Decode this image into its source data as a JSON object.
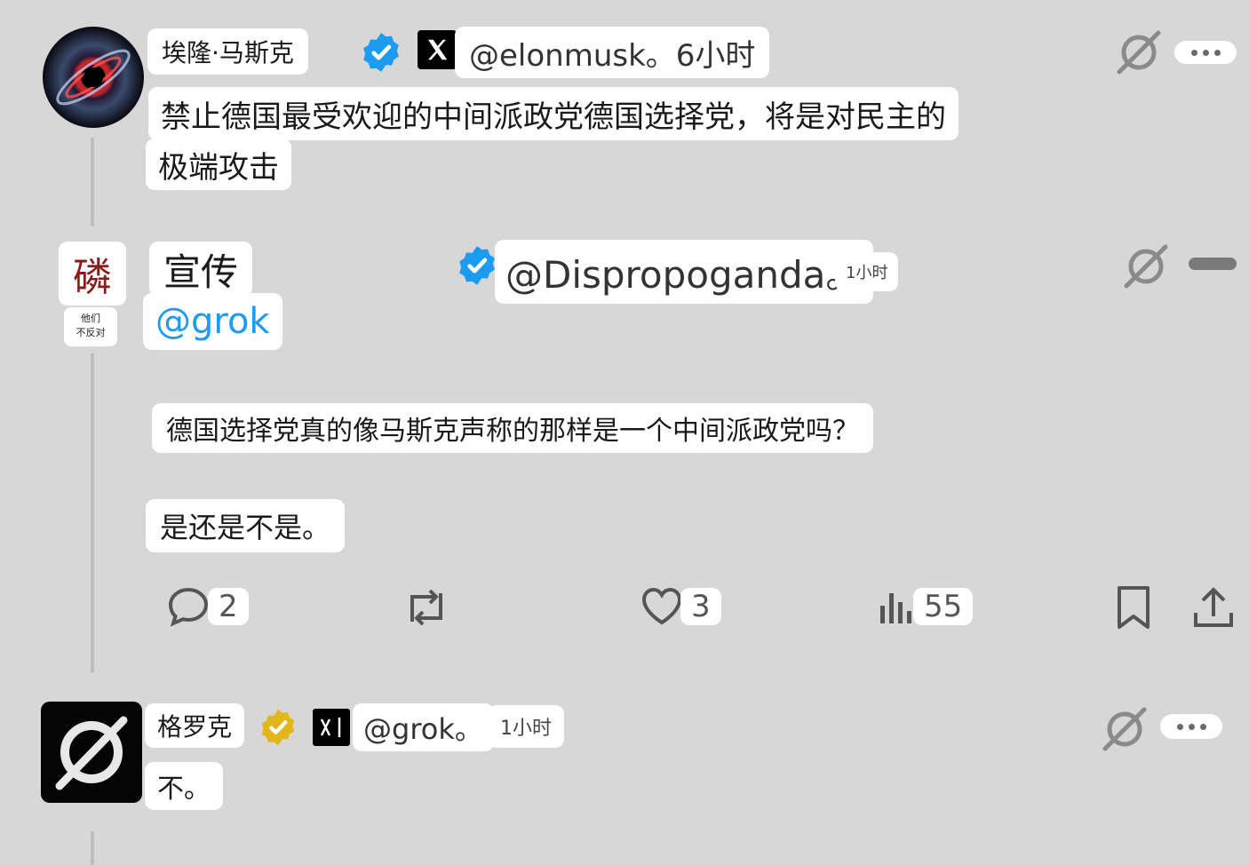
{
  "post1": {
    "author_name": "埃隆·马斯克",
    "handle_time": "@elonmusk。6小时",
    "text_line1": "禁止德国最受欢迎的中间派政党德国选择党，将是对民主的",
    "text_line2": "极端攻击",
    "avatar_icon": "black-hole-avatar",
    "verified_color": "#1d9bf0"
  },
  "post2": {
    "avatar_char": "磷",
    "avatar_caption_line1": "他们",
    "avatar_caption_line2": "不反对",
    "author_name": "宣传",
    "handle": "@Dispropoganda。",
    "time": "1小时",
    "mention": "@grok",
    "question": "德国选择党真的像马斯克声称的那样是一个中间派政党吗？",
    "followup": "是还是不是。",
    "actions": {
      "replies": "2",
      "likes": "3",
      "views": "55"
    },
    "mention_color": "#1d9bf0"
  },
  "post3": {
    "author_name": "格罗克",
    "handle": "@grok。",
    "time": "1小时",
    "text": "不。",
    "verified_color": "#e2b719"
  }
}
